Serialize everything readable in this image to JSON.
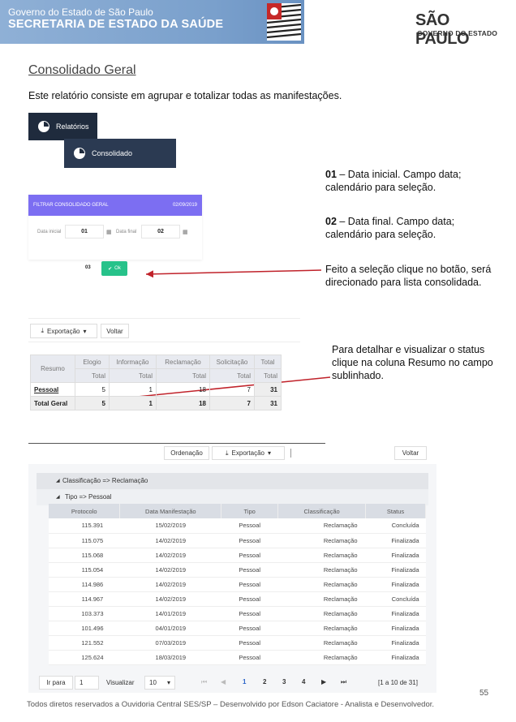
{
  "header": {
    "line1": "Governo do Estado de São Paulo",
    "line2": "SECRETARIA DE ESTADO DA SAÚDE",
    "logo_main": "SÃO PAULO",
    "logo_sub": "GOVERNO DO ESTADO"
  },
  "title": "Consolidado  Geral",
  "intro": "Este relatório consiste em agrupar e totalizar todas as manifestações.",
  "menu": {
    "reports": "Relatórios",
    "consolidated": "Consolidado"
  },
  "notes": {
    "n1_num": "01",
    "n1_text": " – Data inicial. Campo data; calendário para seleção.",
    "n2_num": "02",
    "n2_text": " – Data final. Campo data; calendário para seleção.",
    "n3": "Feito a seleção clique no botão, será direcionado para lista consolidada.",
    "n4": "Para detalhar e visualizar o status clique na coluna Resumo no campo sublinhado."
  },
  "filter": {
    "title": "FILTRAR CONSOLIDADO GERAL",
    "date": "02/09/2019",
    "start_label": "Data inicial",
    "start_value": "01",
    "end_label": "Data final",
    "end_value": "02",
    "num03": "03",
    "ok": "Ok"
  },
  "toolbar": {
    "export": "Exportação",
    "back": "Voltar",
    "order": "Ordenação"
  },
  "summary": {
    "resumo": "Resumo",
    "cols": [
      "Elogio",
      "Informação",
      "Reclamação",
      "Solicitação",
      "Total"
    ],
    "sub": "Total",
    "row": {
      "label": "Pessoal",
      "values": [
        "5",
        "1",
        "18",
        "7",
        "31"
      ]
    },
    "total": {
      "label": "Total Geral",
      "values": [
        "5",
        "1",
        "18",
        "7",
        "31"
      ]
    }
  },
  "grid": {
    "group1": "Classificação => Reclamação",
    "group2": "Tipo => Pessoal",
    "columns": [
      "Protocolo",
      "Data Manifestação",
      "Tipo",
      "Classificação",
      "Status"
    ],
    "rows": [
      [
        "115.391",
        "15/02/2019",
        "Pessoal",
        "Reclamação",
        "Concluída"
      ],
      [
        "115.075",
        "14/02/2019",
        "Pessoal",
        "Reclamação",
        "Finalizada"
      ],
      [
        "115.068",
        "14/02/2019",
        "Pessoal",
        "Reclamação",
        "Finalizada"
      ],
      [
        "115.054",
        "14/02/2019",
        "Pessoal",
        "Reclamação",
        "Finalizada"
      ],
      [
        "114.986",
        "14/02/2019",
        "Pessoal",
        "Reclamação",
        "Finalizada"
      ],
      [
        "114.967",
        "14/02/2019",
        "Pessoal",
        "Reclamação",
        "Concluída"
      ],
      [
        "103.373",
        "14/01/2019",
        "Pessoal",
        "Reclamação",
        "Finalizada"
      ],
      [
        "101.496",
        "04/01/2019",
        "Pessoal",
        "Reclamação",
        "Finalizada"
      ],
      [
        "121.552",
        "07/03/2019",
        "Pessoal",
        "Reclamação",
        "Finalizada"
      ],
      [
        "125.624",
        "18/03/2019",
        "Pessoal",
        "Reclamação",
        "Finalizada"
      ]
    ]
  },
  "pager": {
    "goto": "Ir para",
    "page_value": "1",
    "view": "Visualizar",
    "size": "10",
    "pages": [
      "1",
      "2",
      "3",
      "4"
    ],
    "range": "[1 a 10 de 31]"
  },
  "footer": "Todos diretos reservados a Ouvidoria Central SES/SP – Desenvolvido por Edson Caciatore - Analista e Desenvolvedor.",
  "page_number": "55",
  "colors": {
    "brand_blue": "#7aa0cc",
    "filter_purple": "#7c6ef2",
    "ok_green": "#27c28a",
    "menu_dark": "#1f2b3d",
    "arrow_red": "#c0222a"
  }
}
